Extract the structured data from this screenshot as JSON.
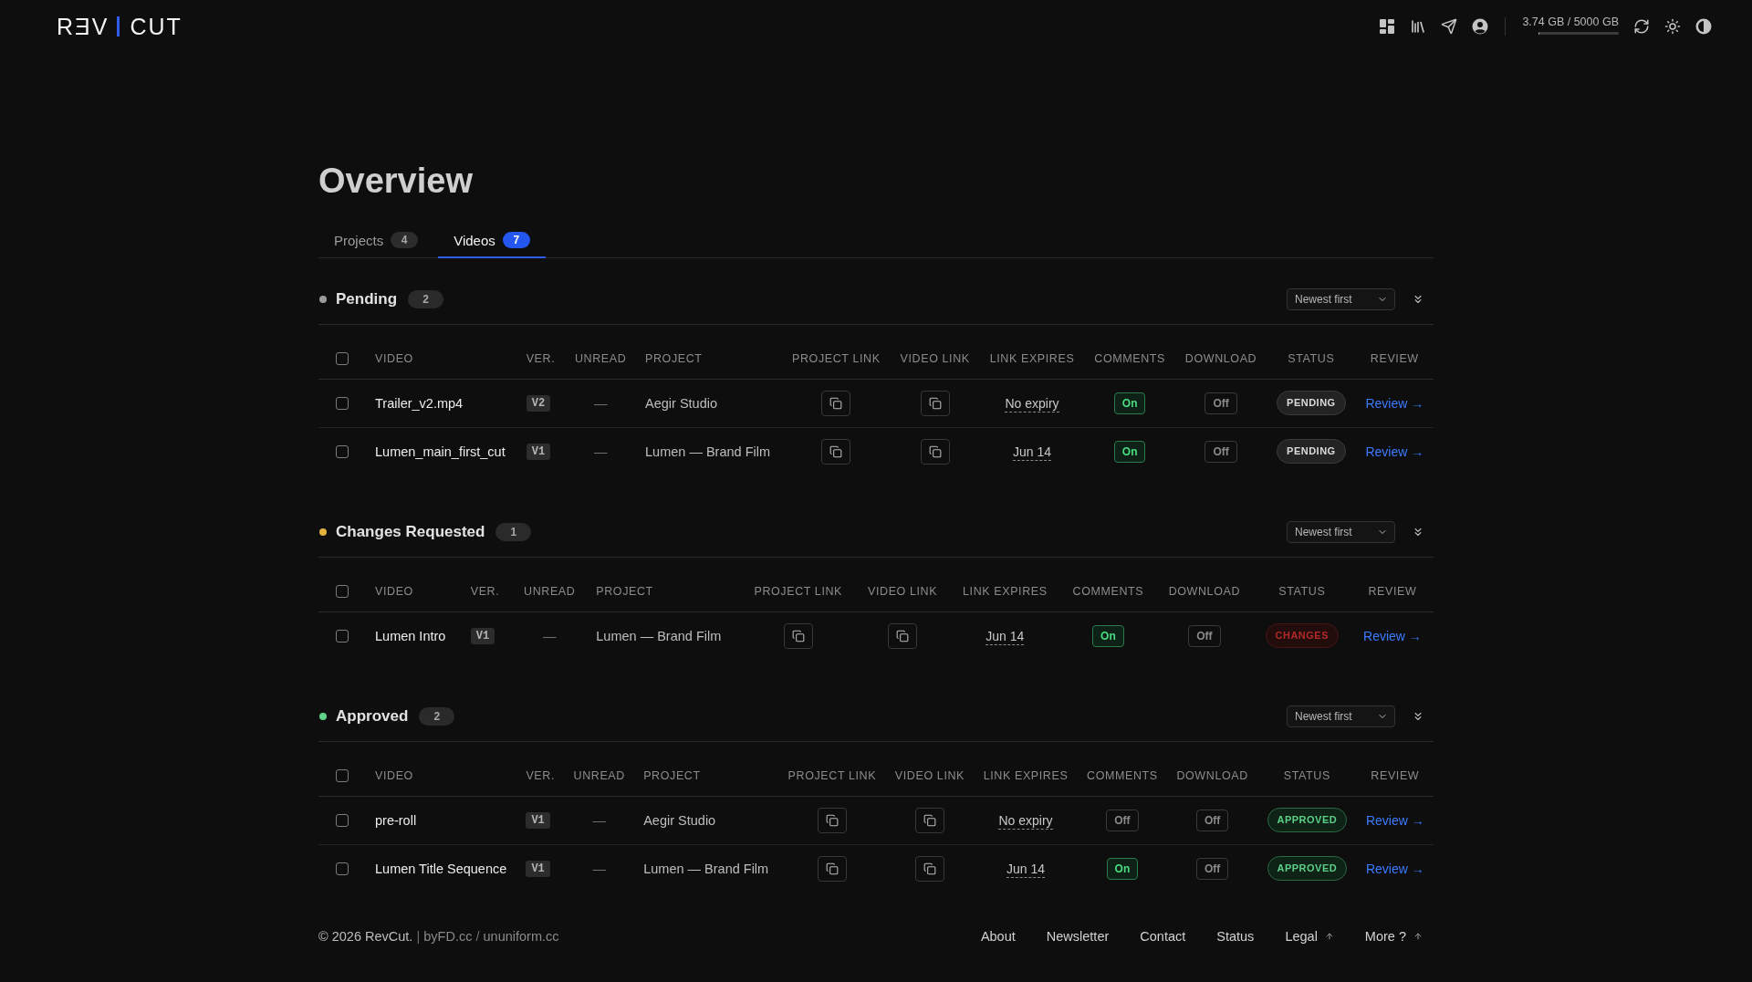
{
  "header": {
    "logo": {
      "left": "RƎV",
      "right": "CUT"
    },
    "storage": {
      "text": "3.74 GB / 5000 GB",
      "level": 0.001
    }
  },
  "page": {
    "title": "Overview"
  },
  "tabs": [
    {
      "label": "Projects",
      "count": "4",
      "selected": false
    },
    {
      "label": "Videos",
      "count": "7",
      "selected": true
    }
  ],
  "sections": [
    {
      "title": "Pending",
      "count": "2",
      "color": "#9b9b9b",
      "sort": "Newest first",
      "select_all": {
        "checked": false
      },
      "columns": [
        "VIDEO",
        "VER.",
        "UNREAD",
        "PROJECT",
        "PROJECT LINK",
        "VIDEO LINK",
        "LINK EXPIRES",
        "COMMENTS",
        "DOWNLOAD",
        "STATUS",
        "REVIEW"
      ],
      "rows": [
        {
          "checked": false,
          "video": "Trailer_v2.mp4",
          "version": "V2",
          "unread": "—",
          "project": "Aegir Studio",
          "link_expires": "No expiry",
          "comments": {
            "label": "On",
            "on": true
          },
          "download": {
            "label": "Off",
            "on": false
          },
          "status": {
            "label": "PENDING",
            "kind": "pending"
          },
          "review": "Review →"
        },
        {
          "checked": false,
          "video": "Lumen_main_first_cut",
          "version": "V1",
          "unread": "—",
          "project": "Lumen — Brand Film",
          "link_expires": "Jun 14",
          "comments": {
            "label": "On",
            "on": true
          },
          "download": {
            "label": "Off",
            "on": false
          },
          "status": {
            "label": "PENDING",
            "kind": "pending"
          },
          "review": "Review →"
        }
      ]
    },
    {
      "title": "Changes Requested",
      "count": "1",
      "color": "#e3b341",
      "sort": "Newest first",
      "select_all": {
        "checked": false
      },
      "columns": [
        "VIDEO",
        "VER.",
        "UNREAD",
        "PROJECT",
        "PROJECT LINK",
        "VIDEO LINK",
        "LINK EXPIRES",
        "COMMENTS",
        "DOWNLOAD",
        "STATUS",
        "REVIEW"
      ],
      "rows": [
        {
          "checked": false,
          "video": "Lumen Intro",
          "version": "V1",
          "unread": "—",
          "project": "Lumen — Brand Film",
          "link_expires": "Jun 14",
          "comments": {
            "label": "On",
            "on": true
          },
          "download": {
            "label": "Off",
            "on": false
          },
          "status": {
            "label": "CHANGES",
            "kind": "changes"
          },
          "review": "Review →"
        }
      ]
    },
    {
      "title": "Approved",
      "count": "2",
      "color": "#5fd38a",
      "sort": "Newest first",
      "select_all": {
        "checked": false
      },
      "columns": [
        "VIDEO",
        "VER.",
        "UNREAD",
        "PROJECT",
        "PROJECT LINK",
        "VIDEO LINK",
        "LINK EXPIRES",
        "COMMENTS",
        "DOWNLOAD",
        "STATUS",
        "REVIEW"
      ],
      "rows": [
        {
          "checked": false,
          "video": "pre-roll",
          "version": "V1",
          "unread": "—",
          "project": "Aegir Studio",
          "link_expires": "No expiry",
          "comments": {
            "label": "Off",
            "on": false
          },
          "download": {
            "label": "Off",
            "on": false
          },
          "status": {
            "label": "APPROVED",
            "kind": "approved"
          },
          "review": "Review →"
        },
        {
          "checked": false,
          "video": "Lumen Title Sequence",
          "version": "V1",
          "unread": "—",
          "project": "Lumen — Brand Film",
          "link_expires": "Jun 14",
          "comments": {
            "label": "On",
            "on": true
          },
          "download": {
            "label": "Off",
            "on": false
          },
          "status": {
            "label": "APPROVED",
            "kind": "approved"
          },
          "review": "Review →"
        }
      ]
    }
  ],
  "footer": {
    "credit": {
      "text": "© 2026 RevCut.",
      "separator": "|",
      "links": [
        "byFD.cc",
        "ununiform.cc"
      ],
      "link_separator": "/"
    },
    "nav": [
      {
        "label": "About",
        "has_menu": false
      },
      {
        "label": "Newsletter",
        "has_menu": false
      },
      {
        "label": "Contact",
        "has_menu": false
      },
      {
        "label": "Status",
        "has_menu": false
      },
      {
        "label": "Legal",
        "has_menu": true
      },
      {
        "label": "More ?",
        "has_menu": true
      }
    ]
  }
}
